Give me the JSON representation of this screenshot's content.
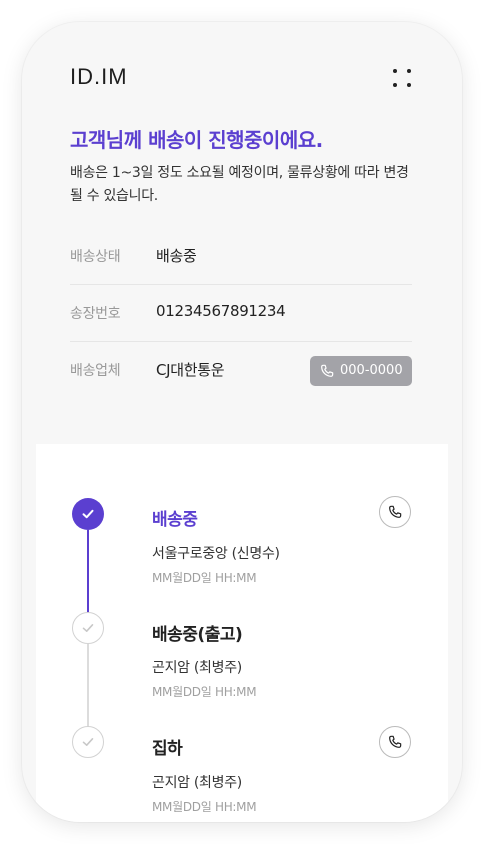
{
  "header": {
    "logo": "ID.IM"
  },
  "hero": {
    "headline": "고객님께 배송이 진행중이에요.",
    "description": "배송은 1~3일 정도 소요될 예정이며, 물류상황에 따라 변경될 수 있습니다."
  },
  "info": {
    "rows": [
      {
        "label": "배송상태",
        "value": "배송중"
      },
      {
        "label": "송장번호",
        "value": "01234567891234"
      },
      {
        "label": "배송업체",
        "value": "CJ대한통운",
        "phone": "000-0000"
      }
    ]
  },
  "timeline": {
    "steps": [
      {
        "title": "배송중",
        "place": "서울구로중앙 (신명수)",
        "time": "MM월DD일 HH:MM",
        "status": "active",
        "has_call": true
      },
      {
        "title": "배송중(출고)",
        "place": "곤지암 (최병주)",
        "time": "MM월DD일 HH:MM",
        "status": "done",
        "has_call": false
      },
      {
        "title": "집하",
        "place": "곤지암 (최병주)",
        "time": "MM월DD일 HH:MM",
        "status": "done",
        "has_call": true
      }
    ]
  },
  "colors": {
    "accent": "#5b3fd0",
    "pill_bg": "#a3a3a8",
    "inactive_border": "#d2d2d2",
    "background_top": "#f7f7f7"
  },
  "icons": {
    "menu": "four-dot-menu-icon",
    "phone": "phone-icon",
    "check": "check-icon"
  }
}
